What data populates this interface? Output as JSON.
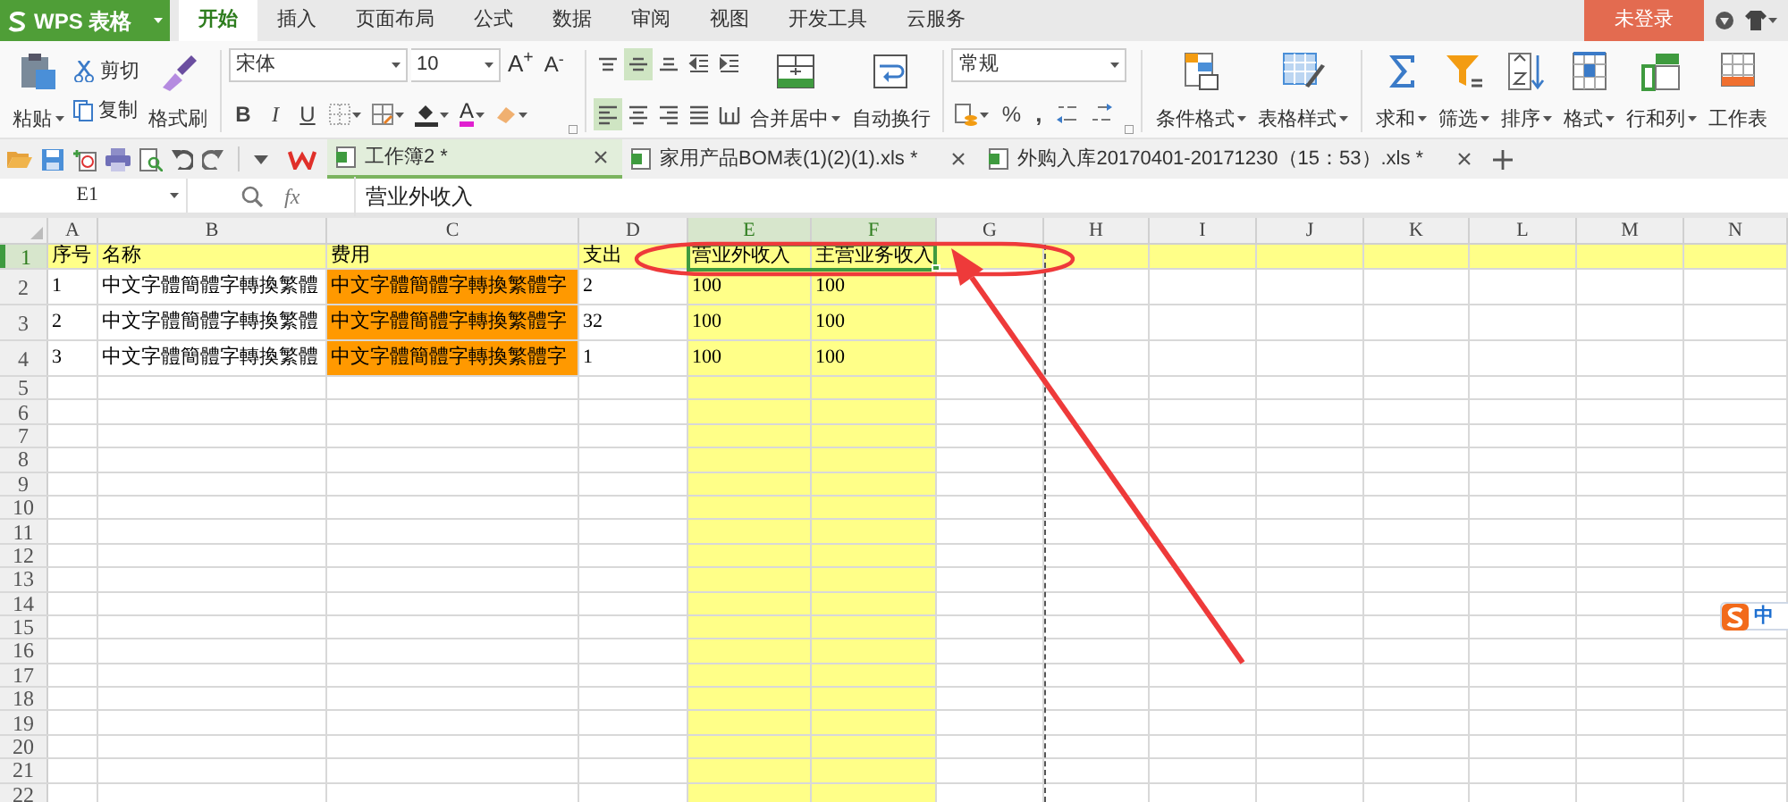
{
  "title_bar": {
    "app_name": "WPS 表格",
    "menu_tabs": [
      {
        "label": "开始",
        "selected": true
      },
      {
        "label": "插入",
        "selected": false
      },
      {
        "label": "页面布局",
        "selected": false
      },
      {
        "label": "公式",
        "selected": false
      },
      {
        "label": "数据",
        "selected": false
      },
      {
        "label": "审阅",
        "selected": false
      },
      {
        "label": "视图",
        "selected": false
      },
      {
        "label": "开发工具",
        "selected": false
      },
      {
        "label": "云服务",
        "selected": false
      }
    ],
    "login_button": "未登录"
  },
  "ribbon": {
    "clipboard": {
      "paste": "粘贴",
      "cut": "剪切",
      "copy": "复制",
      "format_painter": "格式刷"
    },
    "font": {
      "name": "宋体",
      "size": "10",
      "grow": "A$^{+}$",
      "shrink": "A$^{-}$",
      "bold": "B",
      "italic": "I",
      "underline": "U",
      "font_color": "A"
    },
    "alignment": {
      "vertical": [
        {
          "selected": false
        },
        {
          "selected": true
        },
        {
          "selected": false
        }
      ],
      "horizontal": [
        {
          "selected": true
        },
        {
          "selected": false
        },
        {
          "selected": false
        },
        {
          "selected": false
        },
        {
          "selected": false
        }
      ],
      "merge": "合并居中",
      "wrap": "自动换行"
    },
    "number": {
      "format": "常规",
      "percent": "%",
      "comma": ","
    },
    "styles": {
      "conditional_format": "条件格式",
      "table_style": "表格样式"
    },
    "editing": [
      "求和",
      "筛选",
      "排序",
      "格式",
      "行和列",
      "工作表"
    ]
  },
  "document_tabs": [
    {
      "label": "工作簿2 *",
      "selected": true
    },
    {
      "label": "家用产品BOM表(1)(2)(1).xls *",
      "selected": false
    },
    {
      "label": "外购入库20170401-20171230（15：53）.xls *",
      "selected": false
    }
  ],
  "formula_bar": {
    "name_box": "E1",
    "fx": "fx",
    "content": "营业外收入"
  },
  "sheet": {
    "columns": [
      {
        "letter": "A",
        "selected": false
      },
      {
        "letter": "B",
        "selected": false
      },
      {
        "letter": "C",
        "selected": false
      },
      {
        "letter": "D",
        "selected": false
      },
      {
        "letter": "E",
        "selected": true,
        "color": "#ffff88"
      },
      {
        "letter": "F",
        "selected": true,
        "color": "#ffff88"
      },
      {
        "letter": "G",
        "selected": false
      },
      {
        "letter": "H",
        "selected": false
      },
      {
        "letter": "I",
        "selected": false
      },
      {
        "letter": "J",
        "selected": false
      },
      {
        "letter": "K",
        "selected": false
      },
      {
        "letter": "L",
        "selected": false
      },
      {
        "letter": "M",
        "selected": false
      },
      {
        "letter": "N",
        "selected": false
      }
    ],
    "rows": [
      {
        "number": "1",
        "selected": true,
        "color": "#ffff88",
        "cells": [
          {
            "text": "序号"
          },
          {
            "text": "名称"
          },
          {
            "text": "费用"
          },
          {
            "text": "支出"
          },
          {
            "text": "营业外收入"
          },
          {
            "text": "主营业务收入"
          }
        ]
      },
      {
        "number": "2",
        "selected": false,
        "cells": [
          {
            "text": "1"
          },
          {
            "text": "中文字體簡體字轉換繁體"
          },
          {
            "text": "中文字體簡體字轉換繁體字",
            "color": "#ff9900"
          },
          {
            "text": "2"
          },
          {
            "text": "100"
          },
          {
            "text": "100"
          }
        ]
      },
      {
        "number": "3",
        "selected": false,
        "cells": [
          {
            "text": "2"
          },
          {
            "text": "中文字體簡體字轉換繁體"
          },
          {
            "text": "中文字體簡體字轉換繁體字",
            "color": "#ff9900"
          },
          {
            "text": "32"
          },
          {
            "text": "100"
          },
          {
            "text": "100"
          }
        ]
      },
      {
        "number": "4",
        "selected": false,
        "cells": [
          {
            "text": "3"
          },
          {
            "text": "中文字體簡體字轉換繁體"
          },
          {
            "text": "中文字體簡體字轉換繁體字",
            "color": "#ff9900"
          },
          {
            "text": "1"
          },
          {
            "text": "100"
          },
          {
            "text": "100"
          }
        ]
      },
      {
        "number": "5",
        "selected": false
      },
      {
        "number": "6",
        "selected": false
      },
      {
        "number": "7",
        "selected": false
      },
      {
        "number": "8",
        "selected": false
      },
      {
        "number": "9",
        "selected": false
      },
      {
        "number": "10",
        "selected": false
      },
      {
        "number": "11",
        "selected": false
      },
      {
        "number": "12",
        "selected": false
      },
      {
        "number": "13",
        "selected": false
      },
      {
        "number": "14",
        "selected": false
      },
      {
        "number": "15",
        "selected": false
      },
      {
        "number": "16",
        "selected": false
      },
      {
        "number": "17",
        "selected": false
      },
      {
        "number": "18",
        "selected": false
      },
      {
        "number": "19",
        "selected": false
      },
      {
        "number": "20",
        "selected": false
      },
      {
        "number": "21",
        "selected": false
      },
      {
        "number": "22",
        "selected": false
      }
    ]
  },
  "annotations": [
    {
      "kind": "ellipse"
    },
    {
      "kind": "arrow"
    }
  ],
  "input_method": {
    "mode": "中"
  }
}
